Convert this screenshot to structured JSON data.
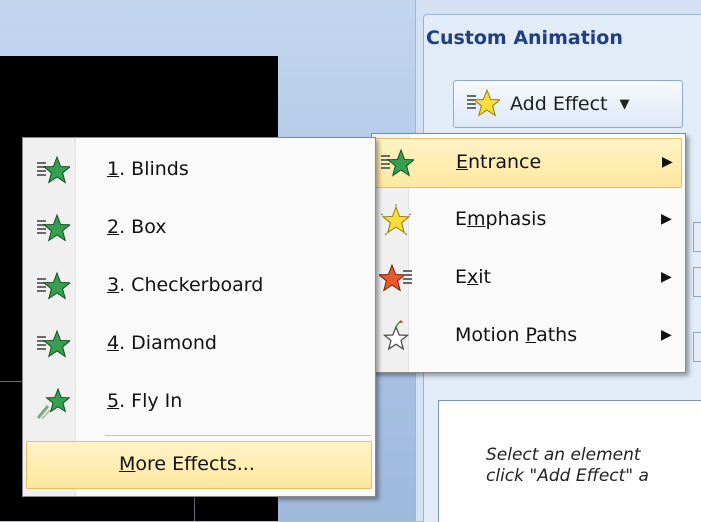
{
  "task_pane": {
    "title": "Custom Animation",
    "add_effect_label": "Add Effect",
    "hint_line1": "Select an element",
    "hint_line2": "click \"Add Effect\" a"
  },
  "add_effect_menu": {
    "items": [
      {
        "mnemonic": "E",
        "rest": "ntrance",
        "icon": "entrance-star-icon",
        "highlighted": true
      },
      {
        "pre": "E",
        "mnemonic": "m",
        "rest": "phasis",
        "icon": "emphasis-star-icon"
      },
      {
        "pre": "E",
        "mnemonic": "x",
        "rest": "it",
        "icon": "exit-star-icon"
      },
      {
        "pre": "Motion ",
        "mnemonic": "P",
        "rest": "aths",
        "icon": "motion-path-star-icon"
      }
    ]
  },
  "entrance_submenu": {
    "items": [
      {
        "mnemonic": "1",
        "rest": ". Blinds",
        "icon": "blinds-effect-icon"
      },
      {
        "mnemonic": "2",
        "rest": ". Box",
        "icon": "box-effect-icon"
      },
      {
        "mnemonic": "3",
        "rest": ". Checkerboard",
        "icon": "checkerboard-effect-icon"
      },
      {
        "mnemonic": "4",
        "rest": ". Diamond",
        "icon": "diamond-effect-icon"
      },
      {
        "mnemonic": "5",
        "rest": ". Fly In",
        "icon": "fly-in-effect-icon"
      }
    ],
    "more": {
      "mnemonic": "M",
      "rest": "ore Effects..."
    }
  }
}
